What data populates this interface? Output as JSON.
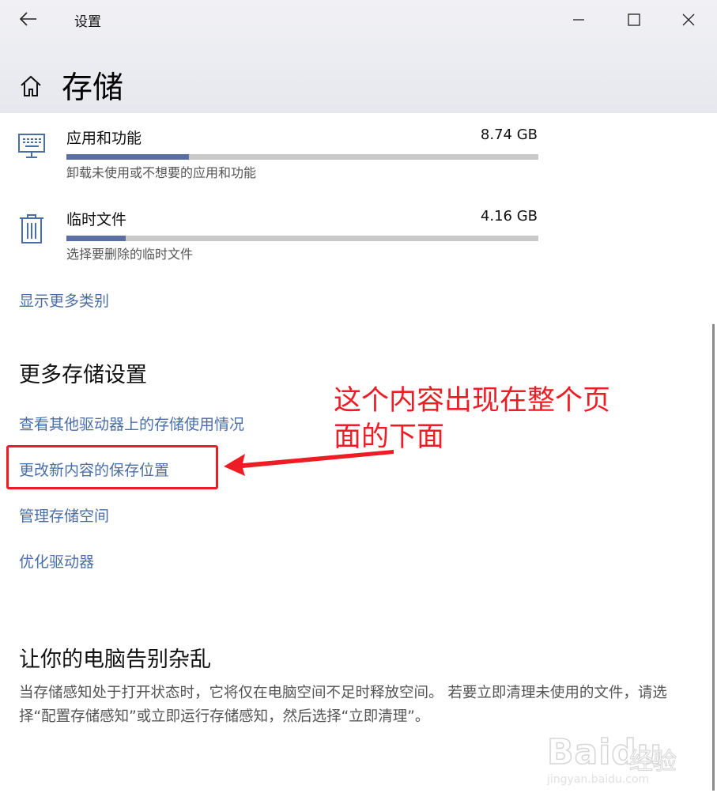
{
  "window": {
    "app_title": "设置",
    "page_title": "存储"
  },
  "categories": [
    {
      "name": "应用和功能",
      "size": "8.74 GB",
      "desc": "卸载未使用或不想要的应用和功能",
      "usage_fraction": 0.26,
      "icon": "keyboard-icon"
    },
    {
      "name": "临时文件",
      "size": "4.16 GB",
      "desc": "选择要删除的临时文件",
      "usage_fraction": 0.125,
      "icon": "trash-icon"
    }
  ],
  "show_more_link": "显示更多类别",
  "more_settings": {
    "heading": "更多存储设置",
    "links": [
      "查看其他驱动器上的存储使用情况",
      "更改新内容的保存位置",
      "管理存储空间",
      "优化驱动器"
    ]
  },
  "declutter": {
    "heading": "让你的电脑告别杂乱",
    "body": "当存储感知处于打开状态时，它将仅在电脑空间不足时释放空间。 若要立即清理未使用的文件，请选择“配置存储感知”或立即运行存储感知，然后选择“立即清理”。"
  },
  "annotation": {
    "text": "这个内容出现在整个页面的下面",
    "color": "#ee1c24"
  },
  "watermark": {
    "logo": "Baidu",
    "cn": "经验",
    "url": "jingyan.baidu.com"
  },
  "colors": {
    "accent_link": "#4a6ea8",
    "bar_fill": "#5c6fa3",
    "bar_track": "#c9c9c9"
  }
}
